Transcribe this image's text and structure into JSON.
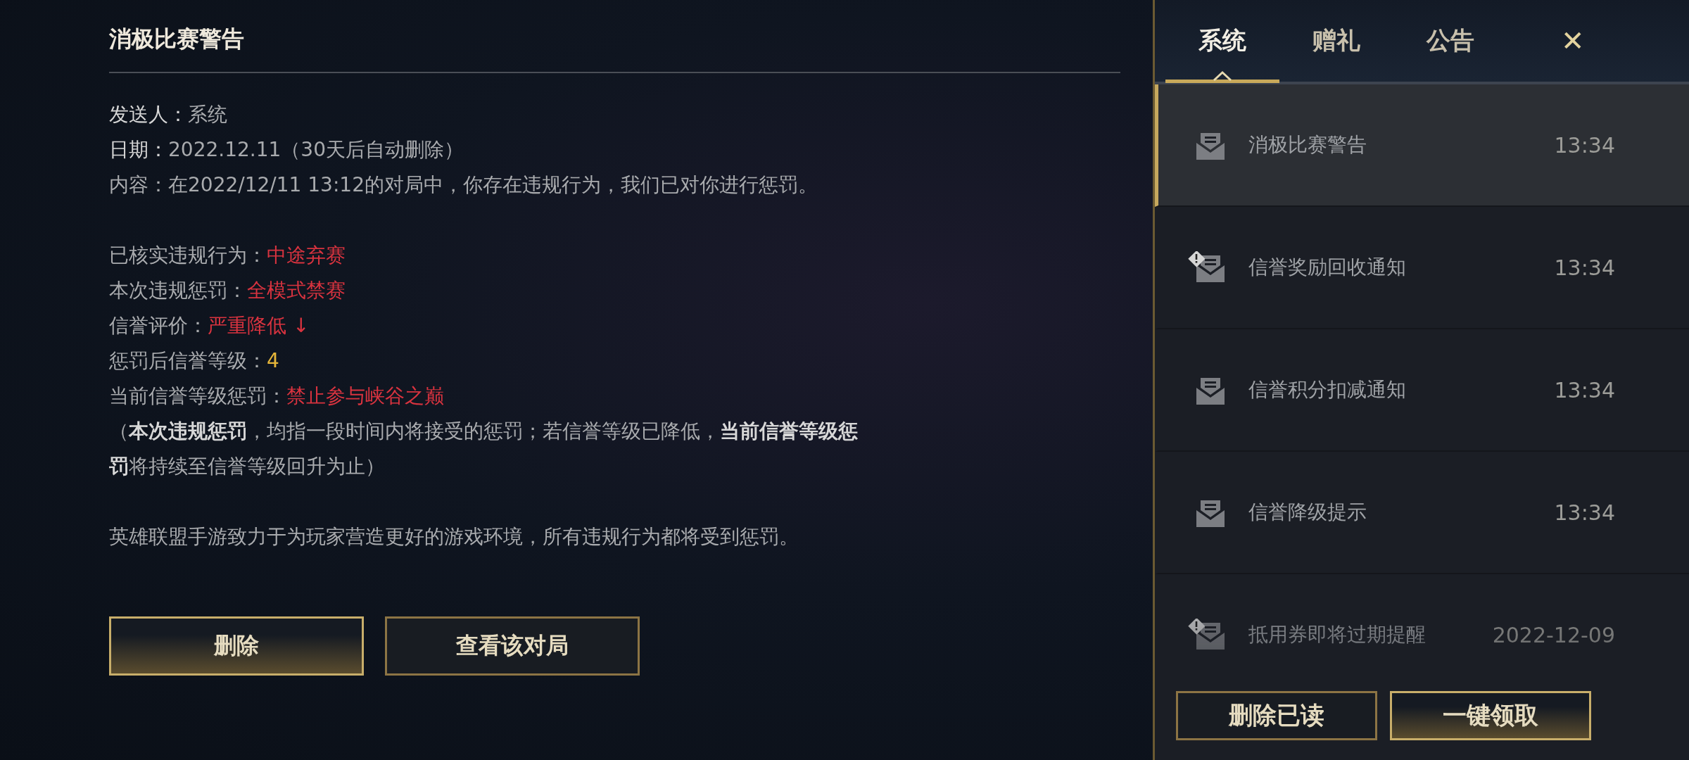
{
  "message": {
    "title": "消极比赛警告",
    "meta": [
      {
        "label": "发送人：",
        "value": "系统"
      },
      {
        "label": "日期：",
        "value": "2022.12.11（30天后自动删除）"
      }
    ],
    "content": {
      "label": "内容：",
      "value": "在2022/12/11 13:12的对局中，你存在违规行为，我们已对你进行惩罚。"
    },
    "fields": [
      {
        "label": "已核实违规行为：",
        "value": "中途弃赛",
        "kind": "alert"
      },
      {
        "label": "本次违规惩罚：",
        "value": "全模式禁赛",
        "kind": "alert"
      },
      {
        "label": "信誉评价：",
        "value": "严重降低 ↓",
        "kind": "alert"
      },
      {
        "label": "惩罚后信誉等级：",
        "value": "4",
        "kind": "level"
      },
      {
        "label": "当前信誉等级惩罚：",
        "value": "禁止参与峡谷之巅",
        "kind": "alert"
      }
    ],
    "note": "（**本次违规惩罚**，均指一段时间内将接受的惩罚；若信誉等级已降低，**当前信誉等级惩罚**将持续至信誉等级回升为止）",
    "footer": "英雄联盟手游致力于为玩家营造更好的游戏环境，所有违规行为都将受到惩罚。",
    "buttons": [
      {
        "label": "删除",
        "kind": "primary"
      },
      {
        "label": "查看该对局",
        "kind": "secondary"
      }
    ]
  },
  "sidebar": {
    "tabs": [
      {
        "label": "系统",
        "selected": true
      },
      {
        "label": "赠礼",
        "selected": false
      },
      {
        "label": "公告",
        "selected": false
      }
    ],
    "close": "✕",
    "items": [
      {
        "title": "消极比赛警告",
        "time": "13:34",
        "alert": false,
        "selected": true
      },
      {
        "title": "信誉奖励回收通知",
        "time": "13:34",
        "alert": true,
        "selected": false
      },
      {
        "title": "信誉积分扣减通知",
        "time": "13:34",
        "alert": false,
        "selected": false
      },
      {
        "title": "信誉降级提示",
        "time": "13:34",
        "alert": false,
        "selected": false
      },
      {
        "title": "抵用券即将过期提醒",
        "time": "2022-12-09",
        "alert": true,
        "selected": false
      }
    ],
    "buttons": [
      {
        "label": "删除已读",
        "kind": "secondary"
      },
      {
        "label": "一键领取",
        "kind": "primary"
      }
    ]
  }
}
